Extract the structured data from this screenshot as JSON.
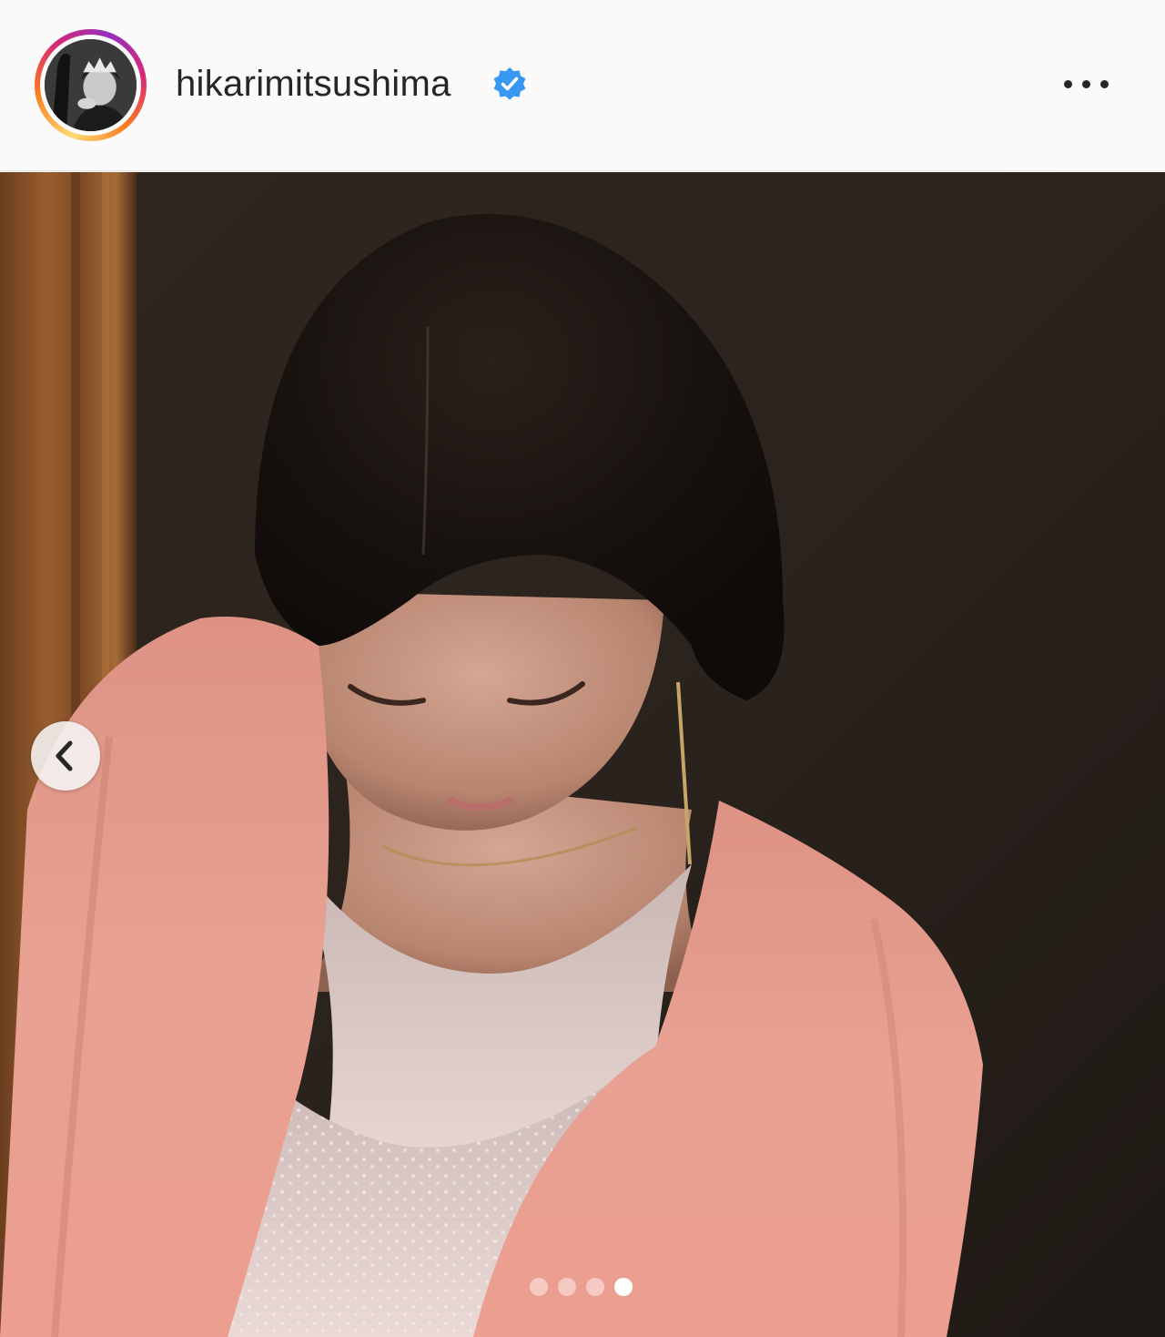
{
  "post": {
    "username": "hikarimitsushima",
    "verified": true,
    "verified_icon": "verified-badge-icon",
    "more_icon": "more-options-icon",
    "avatar_icon": "profile-avatar",
    "story_ring_colors": [
      "#feda75",
      "#fa7e1e",
      "#d62976",
      "#962fbf"
    ],
    "verified_color": "#3897f0"
  },
  "carousel": {
    "prev_icon": "chevron-left-icon",
    "total_slides": 4,
    "current_slide": 4,
    "indicator_dots": [
      {
        "active": false
      },
      {
        "active": false
      },
      {
        "active": false
      },
      {
        "active": true
      }
    ]
  },
  "photo": {
    "subject": "woman-in-pink-sheer-cardigan-looking-down",
    "dominant_colors": [
      "#2a221d",
      "#e9a192",
      "#1b1512",
      "#e8dcd8"
    ]
  }
}
